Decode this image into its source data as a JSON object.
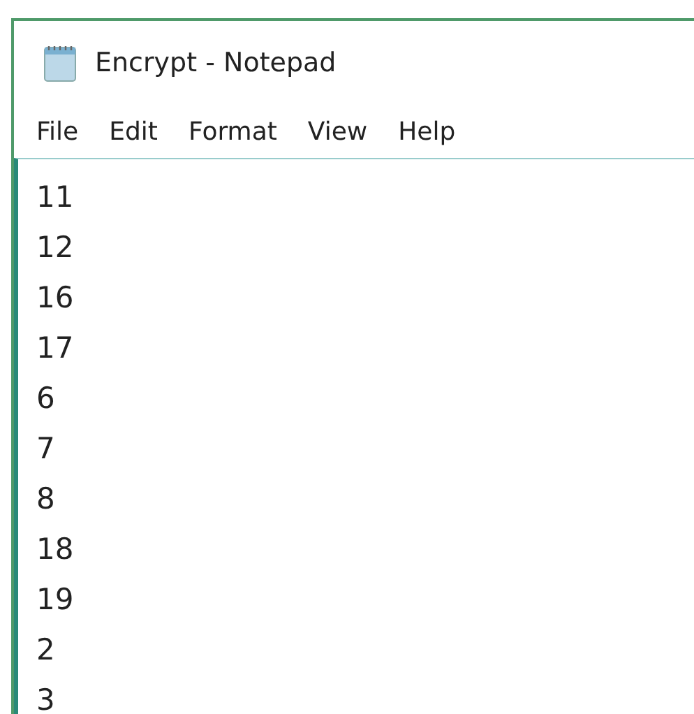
{
  "window": {
    "title": "Encrypt - Notepad"
  },
  "menu": [
    "File",
    "Edit",
    "Format",
    "View",
    "Help"
  ],
  "editor": {
    "lines": [
      "11",
      "12",
      "16",
      "17",
      "6",
      "7",
      "8",
      "18",
      "19",
      "2",
      "3"
    ]
  }
}
